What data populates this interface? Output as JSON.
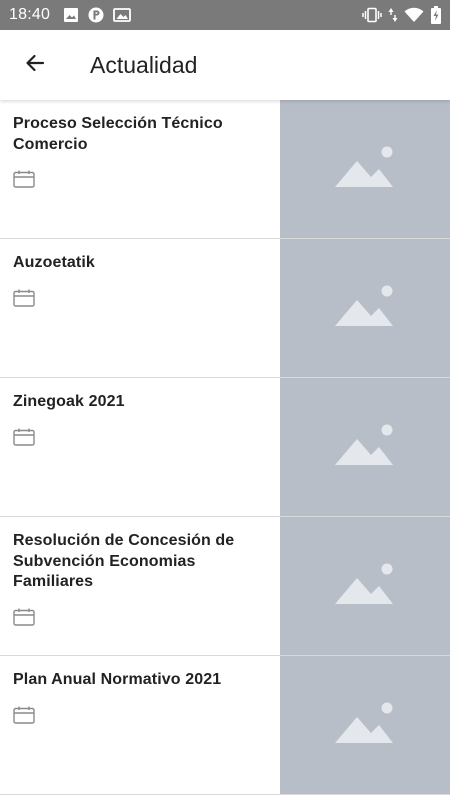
{
  "status_bar": {
    "time": "18:40",
    "left_icons": [
      "image-icon",
      "parking-icon",
      "photo-icon"
    ],
    "right_icons": [
      "vibrate-icon",
      "data-arrows-icon",
      "wifi-icon",
      "battery-charging-icon"
    ]
  },
  "app_bar": {
    "back_icon": "arrow-left-icon",
    "title": "Actualidad"
  },
  "news": {
    "items": [
      {
        "title": "Proceso Selección Técnico Comercio"
      },
      {
        "title": "Auzoetatik"
      },
      {
        "title": "Zinegoak 2021"
      },
      {
        "title": "Resolución de Concesión de Subvención Economias Familiares"
      },
      {
        "title": "Plan Anual Normativo 2021"
      }
    ],
    "thumbnail_icon": "image-placeholder-icon",
    "date_icon": "calendar-icon"
  },
  "colors": {
    "status_bar": "#7a7a7a",
    "thumbnail_bg": "#b8bec8",
    "thumbnail_icon": "#e4e7ec",
    "divider": "#d9d9d9"
  }
}
